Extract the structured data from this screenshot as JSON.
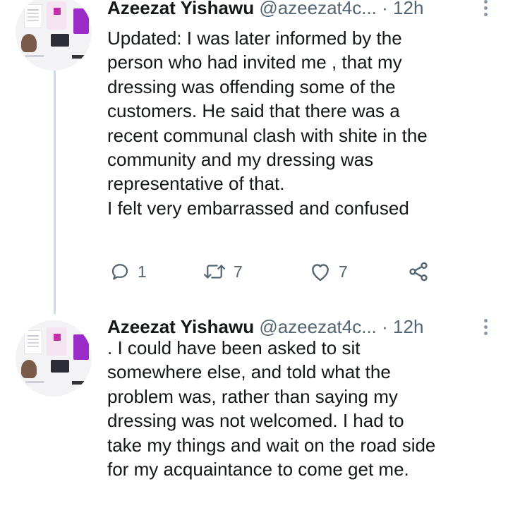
{
  "tweets": [
    {
      "author": {
        "name": "Azeezat Yishawu",
        "handle": "@azeezat4c...",
        "separator": "·",
        "time": "12h",
        "avatar_icon": "profile-collage-avatar"
      },
      "text_lines": [
        "Updated: I was later informed by the",
        "person who had invited me , that my",
        "dressing was offending some of the",
        "customers. He said that there was a",
        "recent communal clash with shite in the",
        "community and my dressing was",
        "representative of that.",
        "I felt very embarrassed and confused"
      ],
      "actions": {
        "reply_count": "1",
        "retweet_count": "7",
        "like_count": "7"
      }
    },
    {
      "author": {
        "name": "Azeezat Yishawu",
        "handle": "@azeezat4c...",
        "separator": "·",
        "time": "12h",
        "avatar_icon": "profile-collage-avatar"
      },
      "text_lines": [
        ". I could have been asked to sit",
        "somewhere else, and told what the",
        "problem was, rather than saying my",
        "dressing was not welcomed. I had to",
        "take my things and wait on the road side",
        "for my acquaintance to come get me."
      ]
    }
  ],
  "icons": {
    "more": "more-vertical-icon",
    "reply": "reply-icon",
    "retweet": "retweet-icon",
    "like": "heart-icon",
    "share": "share-icon"
  },
  "colors": {
    "text": "#14171a",
    "secondary": "#536471",
    "thread_line": "#cfd9de"
  }
}
